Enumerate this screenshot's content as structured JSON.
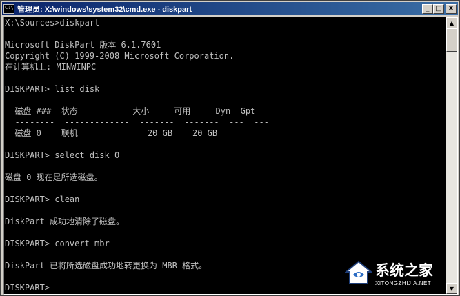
{
  "window": {
    "title": "管理员: X:\\windows\\system32\\cmd.exe - diskpart",
    "app_icon_text": "C:\\",
    "buttons": {
      "minimize": "_",
      "maximize": "□",
      "close": "X"
    }
  },
  "console": {
    "lines": [
      "X:\\Sources>diskpart",
      "",
      "Microsoft DiskPart 版本 6.1.7601",
      "Copyright (C) 1999-2008 Microsoft Corporation.",
      "在计算机上: MINWINPC",
      "",
      "DISKPART> list disk",
      "",
      "  磁盘 ###  状态           大小     可用     Dyn  Gpt",
      "  --------  -------------  -------  -------  ---  ---",
      "  磁盘 0    联机              20 GB    20 GB",
      "",
      "DISKPART> select disk 0",
      "",
      "磁盘 0 现在是所选磁盘。",
      "",
      "DISKPART> clean",
      "",
      "DiskPart 成功地清除了磁盘。",
      "",
      "DISKPART> convert mbr",
      "",
      "DiskPart 已将所选磁盘成功地转更换为 MBR 格式。",
      "",
      "DISKPART>"
    ]
  },
  "scrollbar": {
    "up": "▲",
    "down": "▼"
  },
  "watermark": {
    "title": "系统之家",
    "subtitle": "XITONGZHIJIA.NET"
  },
  "colors": {
    "console_bg": "#000000",
    "console_fg": "#c0c0c0",
    "title_start": "#0a246a",
    "title_end": "#3a6ea5"
  }
}
